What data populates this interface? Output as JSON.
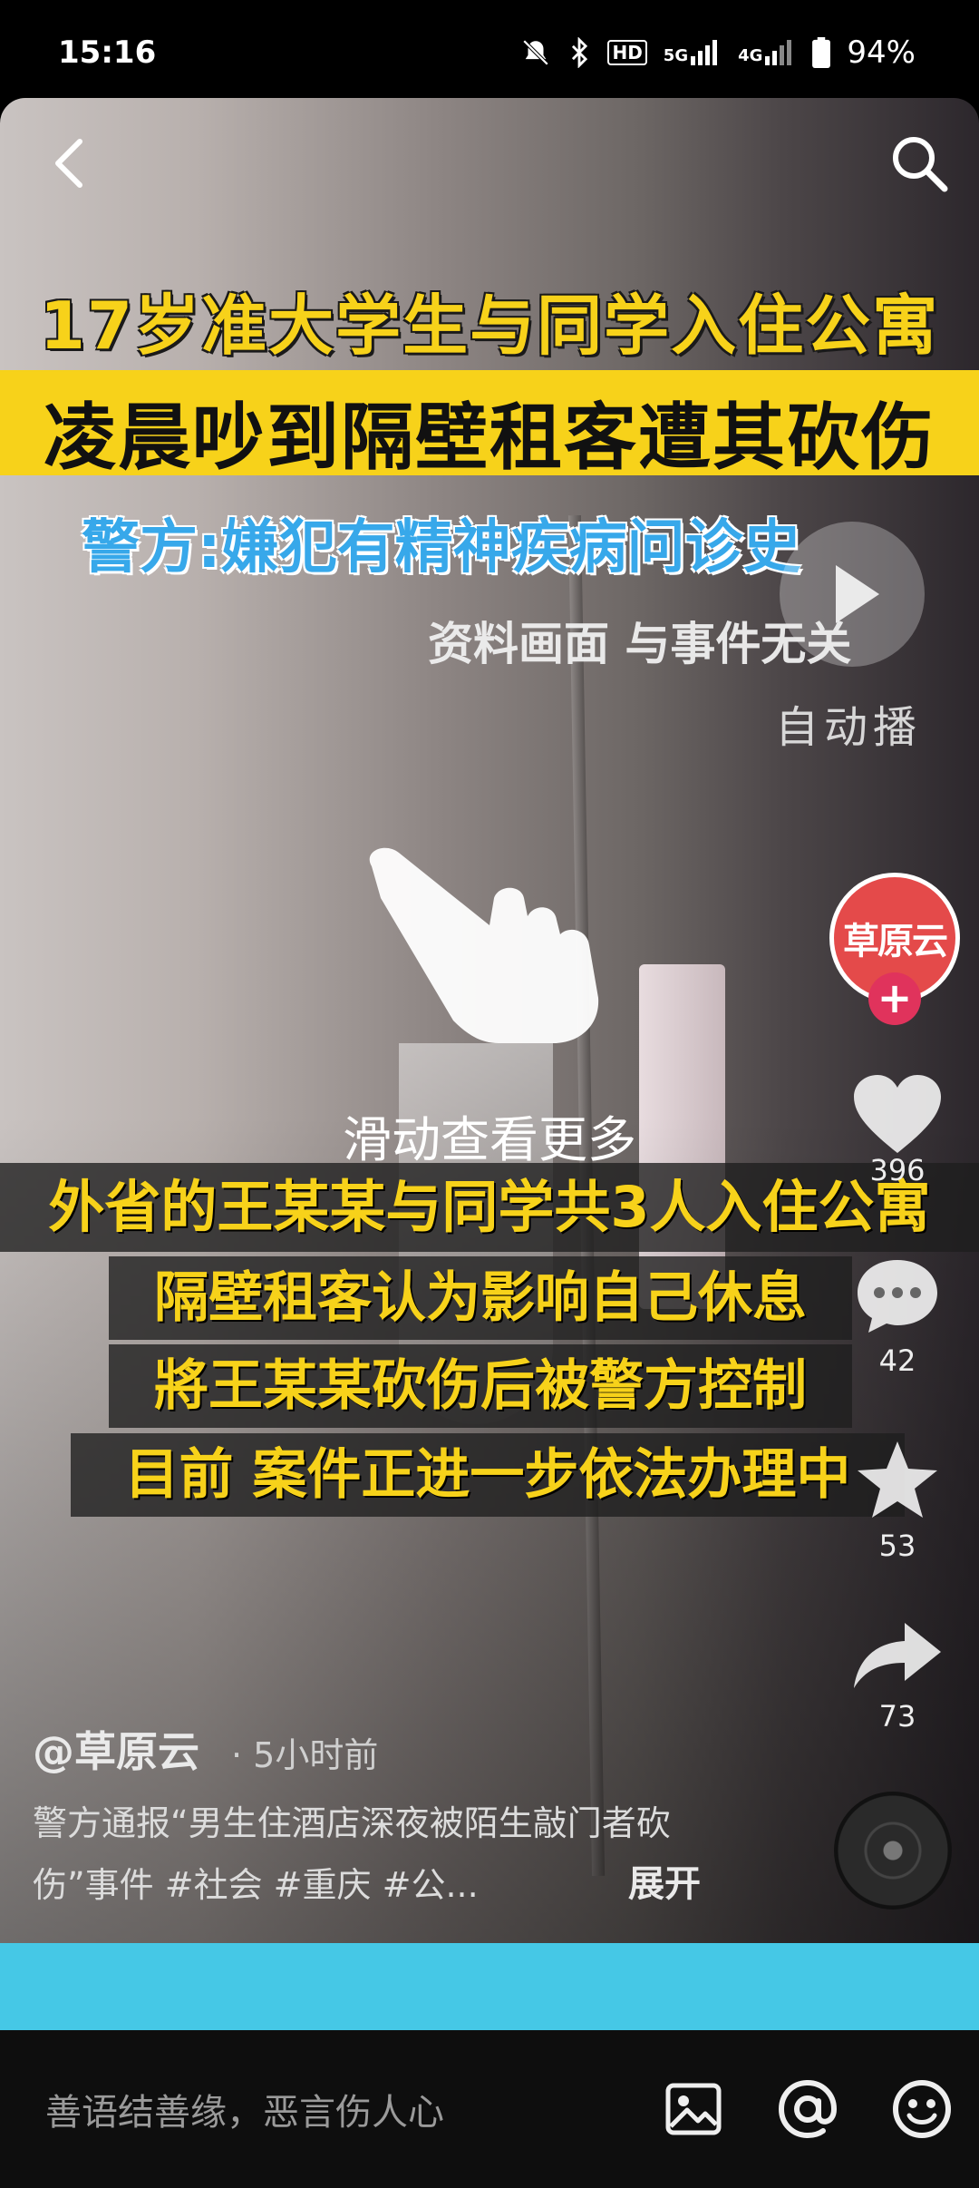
{
  "status_bar": {
    "time": "15:16",
    "battery": "94%",
    "icons": [
      "mute-icon",
      "bluetooth-icon",
      "hd-icon",
      "5g-signal-icon",
      "4g-signal-icon",
      "battery-icon"
    ],
    "hd_label": "HD",
    "net_5g": "5G",
    "net_4g": "4G"
  },
  "video": {
    "caption_line1": "17岁准大学生与同学入住公寓",
    "caption_line2": "凌晨吵到隔壁租客遭其砍伤",
    "caption_line3": "警方:嫌犯有精神疾病问诊史",
    "caption_line4": "资料画面 与事件无关",
    "autoplay_label": "自动播",
    "swipe_hint": "滑动查看更多",
    "lower_lines": [
      "外省的王某某与同学共3人入住公寓",
      "隔壁租客认为影响自己休息",
      "將王某某砍伤后被警方控制",
      "目前 案件正进一步依法办理中"
    ]
  },
  "rail": {
    "avatar_text": "草原云",
    "like_count": "396",
    "comment_count": "42",
    "favorite_count": "53",
    "share_count": "73"
  },
  "post": {
    "author": "@草原云",
    "posted": "· 5小时前",
    "description": "警方通报“男生住酒店深夜被陌生敲门者砍伤”事件 #社会 #重庆 #公...",
    "expand": "展开"
  },
  "comment_bar": {
    "placeholder": "善语结善缘，恶言伤人心"
  },
  "colors": {
    "caption_yellow": "#f7d21a",
    "caption_blue": "#37a8ea",
    "banner_blue": "#45c8e6",
    "follow_red": "#e0335c"
  }
}
